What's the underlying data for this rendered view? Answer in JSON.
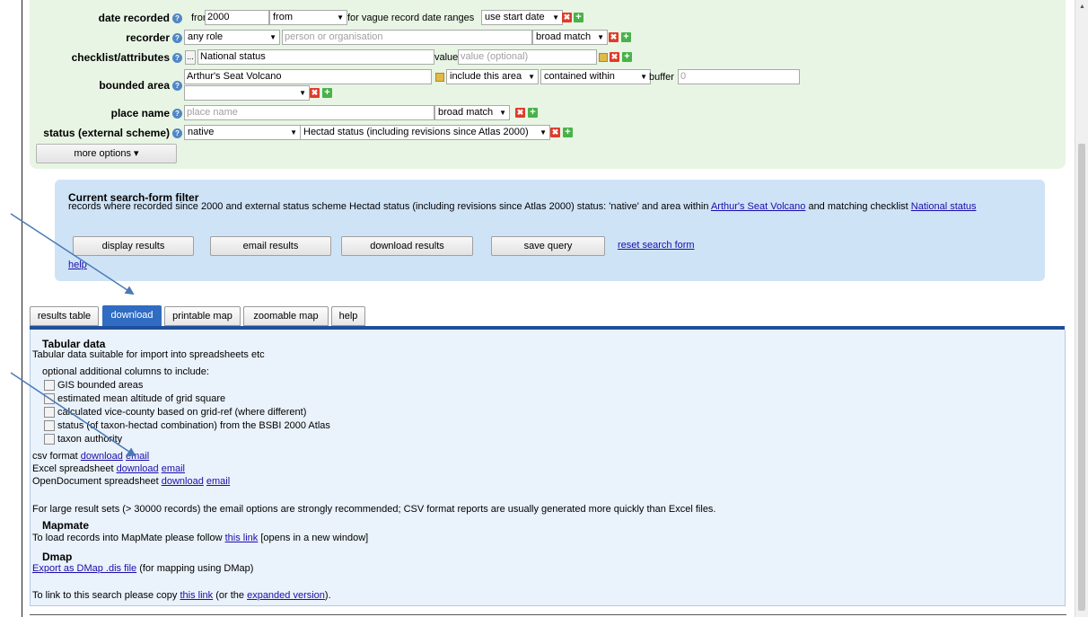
{
  "form": {
    "help_glyph": "?",
    "date_recorded": {
      "label": "date recorded",
      "from_prefix": "from",
      "year_value": "2000",
      "mode_select": "from",
      "vague_text": "for vague record date ranges",
      "vague_select": "use start date"
    },
    "recorder": {
      "label": "recorder",
      "role_select": "any role",
      "person_placeholder": "person or organisation",
      "match_select": "broad match"
    },
    "checklist": {
      "label": "checklist/attributes",
      "ellipsis": "...",
      "value": "National status",
      "value_label": "value",
      "value_placeholder": "value (optional)"
    },
    "bounded_area": {
      "label": "bounded area",
      "value": "Arthur's Seat Volcano",
      "include_select": "include this area",
      "contained_select": "contained within",
      "buffer_label": "buffer",
      "buffer_value": "0",
      "extra_select": ""
    },
    "place_name": {
      "label": "place name",
      "placeholder": "place name",
      "match_select": "broad match"
    },
    "status": {
      "label": "status (external scheme)",
      "status_select": "native",
      "scheme_select": "Hectad status (including revisions since Atlas 2000)"
    },
    "remove_glyph": "✖",
    "add_glyph": "+",
    "more_options": "more options ▾"
  },
  "filter": {
    "title": "Current search-form filter",
    "text_before_area": "records where recorded since 2000 and external status scheme Hectad status (including revisions since Atlas 2000) status: 'native' and area within ",
    "area_link": "Arthur's Seat Volcano",
    "text_before_checklist": " and matching checklist ",
    "checklist_link": "National status",
    "buttons": {
      "display": "display results",
      "email": "email results",
      "download": "download results",
      "save": "save query"
    },
    "reset_link": "reset search form",
    "help_link": "help"
  },
  "tabs": [
    {
      "label": "results table"
    },
    {
      "label": "download",
      "active": true
    },
    {
      "label": "printable map"
    },
    {
      "label": "zoomable map"
    },
    {
      "label": "help"
    }
  ],
  "download": {
    "tabular_heading": "Tabular data",
    "tabular_desc": "Tabular data suitable for import into spreadsheets etc",
    "optional_label": "optional additional columns to include:",
    "options": [
      "GIS bounded areas",
      "estimated mean altitude of grid square",
      "calculated vice-county based on grid-ref (where different)",
      "status (of taxon-hectad combination) from the BSBI 2000 Atlas",
      "taxon authority"
    ],
    "formats": [
      {
        "name": "csv format",
        "download": "download",
        "email": "email"
      },
      {
        "name": "Excel spreadsheet",
        "download": "download",
        "email": "email"
      },
      {
        "name": "OpenDocument spreadsheet",
        "download": "download",
        "email": "email"
      }
    ],
    "large_note": "For large result sets (> 30000 records) the email options are strongly recommended; CSV format reports are usually generated more quickly than Excel files.",
    "mapmate_heading": "Mapmate",
    "mapmate_before": "To load records into MapMate please follow ",
    "mapmate_link": "this link",
    "mapmate_after": " [opens in a new window]",
    "dmap_heading": "Dmap",
    "dmap_link": "Export as DMap .dis file",
    "dmap_after": " (for mapping using DMap)",
    "link_before": "To link to this search please copy ",
    "link_this": "this link",
    "link_middle": " (or the ",
    "link_expanded": "expanded version",
    "link_after": ")."
  },
  "colors": {
    "form_bg": "#e8f5e4",
    "filter_bg": "#cfe3f7",
    "tab_active": "#2f6cc2",
    "annotation_arrow": "#4a7ab5"
  }
}
